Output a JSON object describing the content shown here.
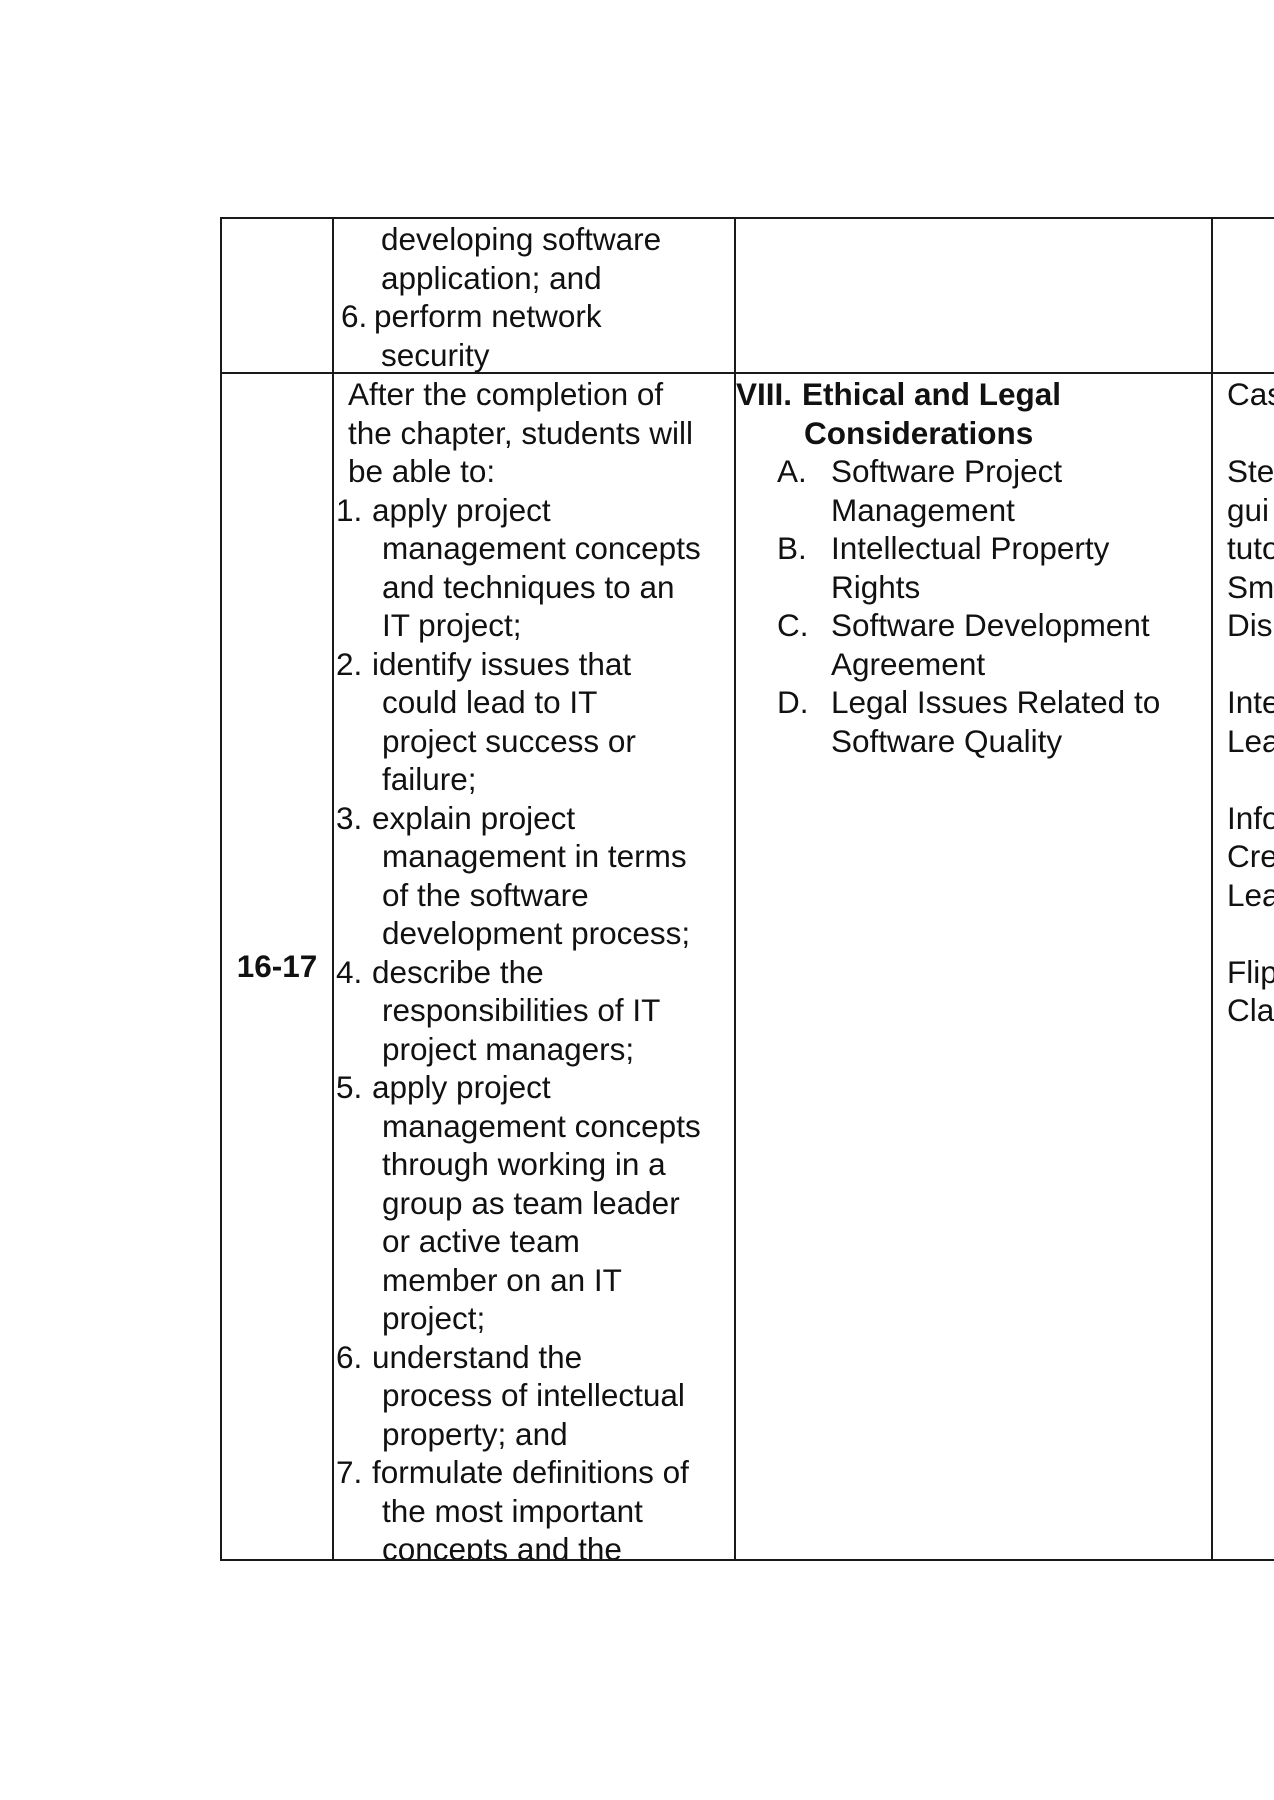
{
  "table": {
    "row1": {
      "outcomes_continued": [
        "developing software",
        "application; and"
      ],
      "item6": {
        "num": "6.",
        "lines": [
          "perform network",
          "security"
        ]
      }
    },
    "row2": {
      "week": "16-17",
      "intro": [
        "After the completion of",
        "the chapter, students will",
        "be able to:"
      ],
      "outcomes": [
        {
          "num": "1.",
          "lines": [
            "apply project",
            "management concepts",
            "and techniques to an",
            "IT project;"
          ]
        },
        {
          "num": "2.",
          "lines": [
            "identify issues that",
            "could lead to IT",
            "project success or",
            "failure;"
          ]
        },
        {
          "num": "3.",
          "lines": [
            "explain project",
            "management in terms",
            "of the software",
            "development process;"
          ]
        },
        {
          "num": "4.",
          "lines": [
            "describe the",
            "responsibilities of IT",
            "project managers;"
          ]
        },
        {
          "num": "5.",
          "lines": [
            "apply project",
            "management concepts",
            "through working in a",
            "group as team leader",
            "or active team",
            "member on an IT",
            "project;"
          ]
        },
        {
          "num": "6.",
          "lines": [
            "understand the",
            "process of intellectual",
            "property; and"
          ]
        },
        {
          "num": "7.",
          "lines": [
            "formulate definitions of",
            "the most important",
            "concepts and the"
          ]
        }
      ],
      "topic": {
        "numeral": "VIII.",
        "title_lines": [
          "Ethical and Legal",
          "Considerations"
        ],
        "subtopics": [
          {
            "letter": "A.",
            "lines": [
              "Software Project",
              "Management"
            ]
          },
          {
            "letter": "B.",
            "lines": [
              "Intellectual Property",
              "Rights"
            ]
          },
          {
            "letter": "C.",
            "lines": [
              "Software Development",
              "Agreement"
            ]
          },
          {
            "letter": "D.",
            "lines": [
              "Legal Issues Related to",
              "Software Quality"
            ]
          }
        ]
      },
      "activities_clipped": [
        "Cas",
        "",
        "Ste",
        "gui",
        "tuto",
        "Sm",
        "Dis",
        "",
        "Inte",
        "Lea",
        "",
        "Info",
        "Cre",
        "Lea",
        "",
        "Flip",
        "Cla"
      ]
    }
  }
}
